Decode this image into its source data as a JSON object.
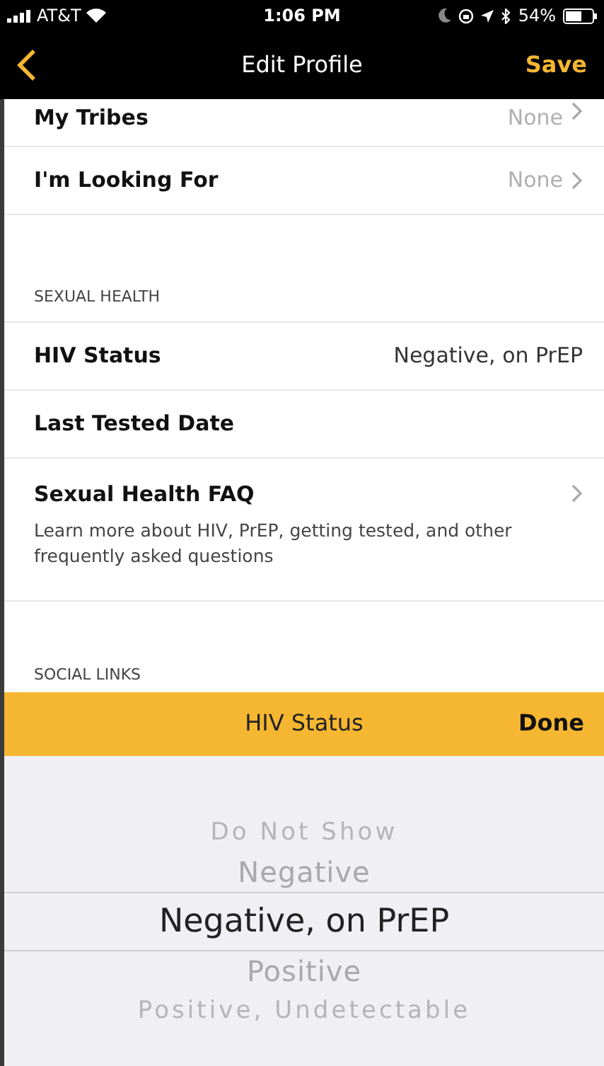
{
  "status_bar": {
    "carrier": "AT&T",
    "time": "1:06 PM",
    "battery": "54%"
  },
  "nav": {
    "title": "Edit Profile",
    "action": "Save"
  },
  "rows_top": [
    {
      "label": "My Tribes",
      "value": "None"
    },
    {
      "label": "I'm Looking For",
      "value": "None"
    }
  ],
  "sexual_health": {
    "header": "SEXUAL HEALTH",
    "rows": [
      {
        "kind": "value",
        "label": "HIV Status",
        "value": "Negative, on PrEP"
      },
      {
        "kind": "plain",
        "label": "Last Tested Date"
      },
      {
        "kind": "link",
        "label": "Sexual Health FAQ",
        "description": "Learn more about HIV, PrEP, getting tested, and other frequently asked questions"
      }
    ]
  },
  "social_links": {
    "header": "SOCIAL LINKS"
  },
  "picker": {
    "title": "HIV Status",
    "done": "Done",
    "options": [
      {
        "label": "Do Not Show",
        "selected": false
      },
      {
        "label": "Negative",
        "selected": false
      },
      {
        "label": "Negative, on PrEP",
        "selected": true
      },
      {
        "label": "Positive",
        "selected": false
      },
      {
        "label": "Positive, Undetectable",
        "selected": false
      }
    ]
  }
}
